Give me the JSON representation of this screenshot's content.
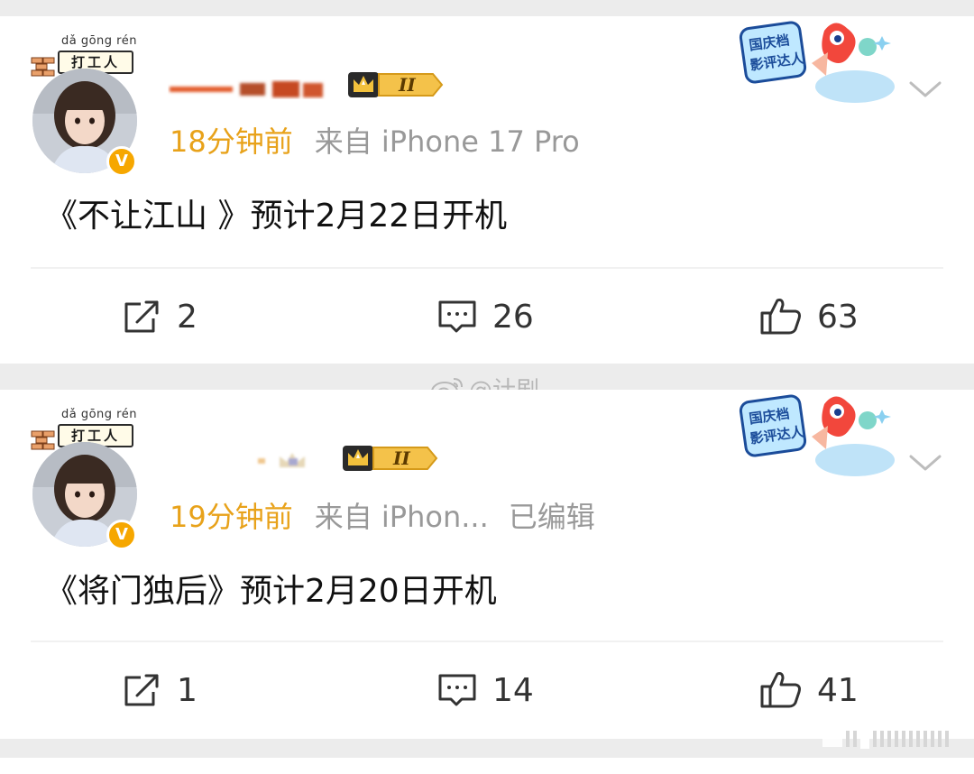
{
  "posts": [
    {
      "pendant": {
        "pinyin": "dǎ gōng rén",
        "text": "打工人"
      },
      "user_level": "II",
      "time": "18分钟前",
      "source": "来自 iPhone 17 Pro",
      "edited": "",
      "content": "《不让江山 》预计2月22日开机",
      "promo_badge": "国庆档影评达人",
      "actions": {
        "repost_count": "2",
        "comment_count": "26",
        "like_count": "63"
      }
    },
    {
      "pendant": {
        "pinyin": "dǎ gōng rén",
        "text": "打工人"
      },
      "user_level": "II",
      "time": "19分钟前",
      "source": "来自 iPhon...",
      "edited": "已编辑",
      "content": "《将门独后》预计2月20日开机",
      "promo_badge": "国庆档影评达人",
      "actions": {
        "repost_count": "1",
        "comment_count": "14",
        "like_count": "41"
      }
    }
  ],
  "watermark": "@计剧",
  "colors": {
    "time": "#e8a21a",
    "meta": "#999999",
    "verified_badge": "#f6a700",
    "background": "#ececec"
  },
  "icons": {
    "verified": "v-badge",
    "repost": "repost-icon",
    "comment": "comment-icon",
    "like": "like-icon",
    "more": "chevron-down-icon",
    "watermark": "weibo-logo-icon"
  }
}
